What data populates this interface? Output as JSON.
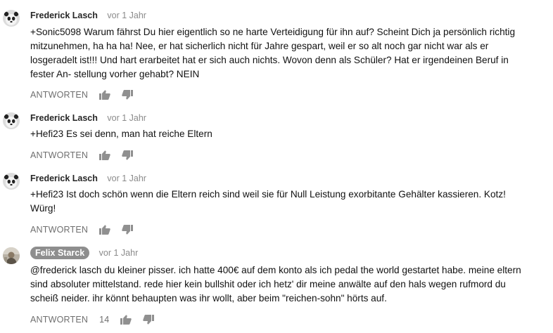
{
  "labels": {
    "reply": "ANTWORTEN"
  },
  "comments": [
    {
      "author": "Frederick Lasch",
      "time": "vor 1 Jahr",
      "avatar": "panda-avatar",
      "text": "+Sonic5098 Warum fährst Du hier eigentlich so ne harte Verteidigung für ihn auf? Scheint Dich ja persönlich richtig mitzunehmen, ha ha ha! Nee, er hat sicherlich nicht für Jahre gespart, weil er so alt noch gar nicht war als er losgeradelt ist!!! Und hart erarbeitet hat er sich auch nichts. Wovon denn als Schüler? Hat er irgendeinen Beruf in fester An- stellung vorher gehabt? NEIN",
      "likes": ""
    },
    {
      "author": "Frederick Lasch",
      "time": "vor 1 Jahr",
      "avatar": "panda-avatar",
      "text": "+Hefi23 Es sei denn, man hat reiche Eltern",
      "likes": ""
    },
    {
      "author": "Frederick Lasch",
      "time": "vor 1 Jahr",
      "avatar": "panda-avatar",
      "text": "+Hefi23 Ist doch schön wenn die Eltern reich sind weil sie für Null Leistung exorbitante Gehälter kassieren. Kotz! Würg!",
      "likes": ""
    },
    {
      "author": "Felix Starck",
      "time": "vor 1 Jahr",
      "avatar": "photo-avatar",
      "text": "@frederick lasch du kleiner pisser. ich hatte 400€ auf dem konto als ich pedal the world gestartet habe. meine eltern sind absoluter mittelstand. rede hier kein bullshit oder ich hetz' dir meine anwälte auf den hals wegen rufmord du scheiß neider. ihr könnt behaupten was ihr wollt, aber beim \"reichen-sohn\" hörts auf.",
      "likes": "14"
    }
  ]
}
